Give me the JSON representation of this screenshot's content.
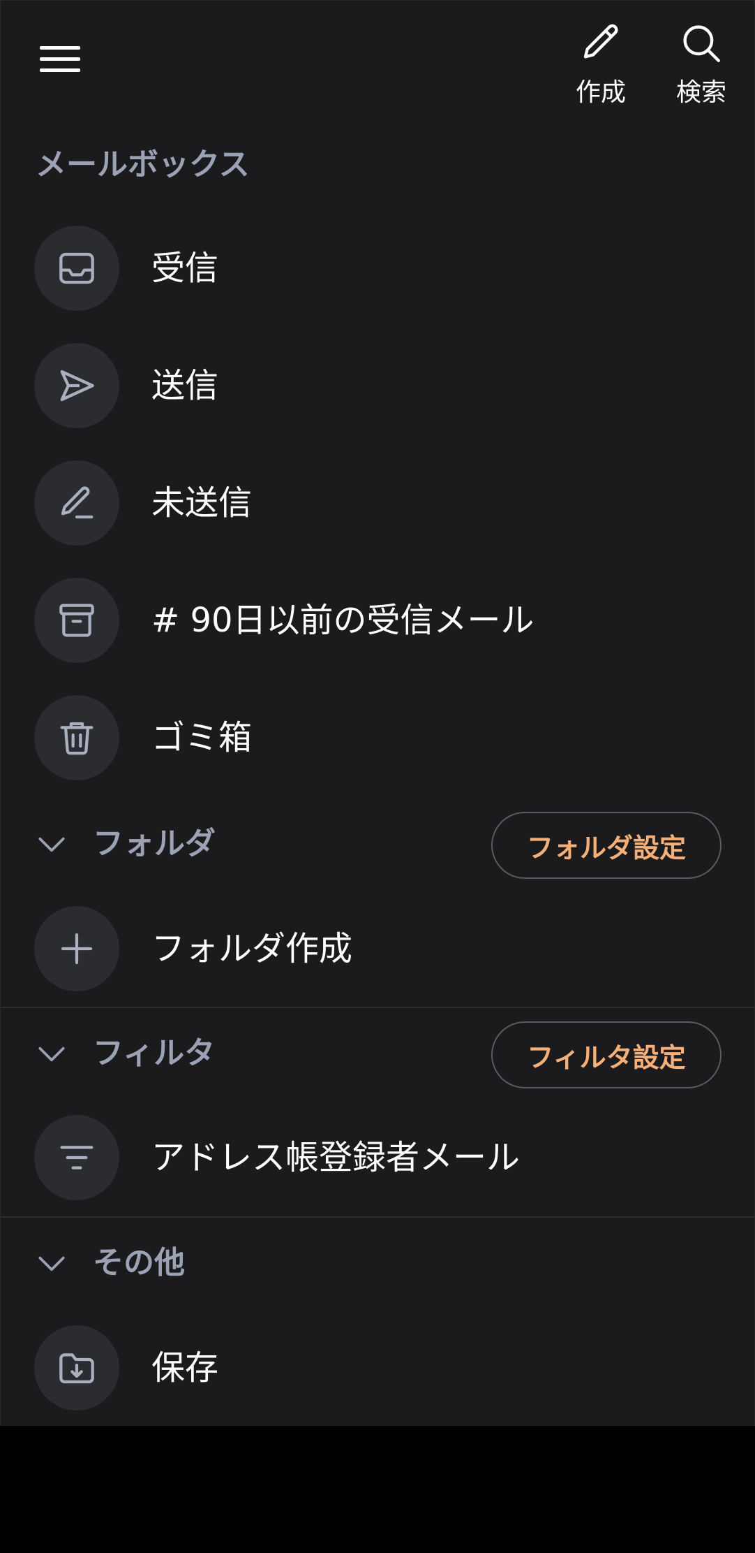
{
  "topbar": {
    "compose_label": "作成",
    "search_label": "検索"
  },
  "mailbox": {
    "title": "メールボックス",
    "items": [
      {
        "label": "受信",
        "icon": "inbox-icon"
      },
      {
        "label": "送信",
        "icon": "send-icon"
      },
      {
        "label": "未送信",
        "icon": "draft-icon"
      },
      {
        "label": "# 90日以前の受信メール",
        "icon": "archive-icon"
      },
      {
        "label": "ゴミ箱",
        "icon": "trash-icon"
      }
    ]
  },
  "folders": {
    "title": "フォルダ",
    "settings_label": "フォルダ設定",
    "items": [
      {
        "label": "フォルダ作成",
        "icon": "plus-icon"
      }
    ]
  },
  "filters": {
    "title": "フィルタ",
    "settings_label": "フィルタ設定",
    "items": [
      {
        "label": "アドレス帳登録者メール",
        "icon": "filter-icon"
      }
    ]
  },
  "others": {
    "title": "その他",
    "items": [
      {
        "label": "保存",
        "icon": "folder-download-icon"
      }
    ]
  },
  "colors": {
    "background": "#1b1b1d",
    "icon_circle": "#2b2c30",
    "section_text": "#9aa2b4",
    "accent": "#f5b07a"
  }
}
